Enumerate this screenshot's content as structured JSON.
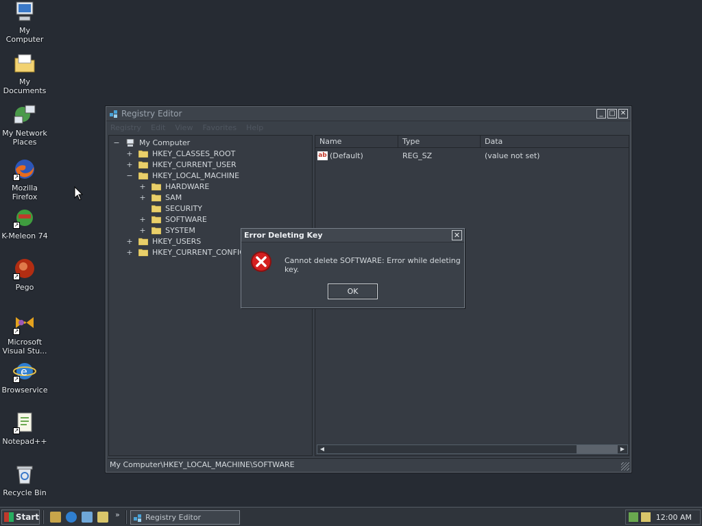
{
  "desktop": {
    "icons": [
      {
        "label": "My Computer",
        "icon": "computer-icon"
      },
      {
        "label": "My Documents",
        "icon": "documents-folder-icon"
      },
      {
        "label": "My Network Places",
        "icon": "network-places-icon"
      },
      {
        "label": "Mozilla Firefox",
        "icon": "firefox-icon"
      },
      {
        "label": "K-Meleon 74",
        "icon": "kmeleon-icon"
      },
      {
        "label": "Pego",
        "icon": "pego-icon"
      },
      {
        "label": "Microsoft Visual Stu...",
        "icon": "visual-studio-icon"
      },
      {
        "label": "Browservice",
        "icon": "internet-explorer-icon"
      },
      {
        "label": "Notepad++",
        "icon": "notepadpp-icon"
      },
      {
        "label": "Recycle Bin",
        "icon": "recycle-bin-icon"
      }
    ]
  },
  "registry": {
    "title": "Registry Editor",
    "menu": [
      "Registry",
      "Edit",
      "View",
      "Favorites",
      "Help"
    ],
    "tree": [
      {
        "label": "My Computer",
        "expander": "−",
        "level": 0,
        "icon": "computer-icon"
      },
      {
        "label": "HKEY_CLASSES_ROOT",
        "expander": "+",
        "level": 1
      },
      {
        "label": "HKEY_CURRENT_USER",
        "expander": "+",
        "level": 1
      },
      {
        "label": "HKEY_LOCAL_MACHINE",
        "expander": "−",
        "level": 1
      },
      {
        "label": "HARDWARE",
        "expander": "+",
        "level": 2
      },
      {
        "label": "SAM",
        "expander": "+",
        "level": 2
      },
      {
        "label": "SECURITY",
        "expander": "",
        "level": 2
      },
      {
        "label": "SOFTWARE",
        "expander": "+",
        "level": 2
      },
      {
        "label": "SYSTEM",
        "expander": "+",
        "level": 2
      },
      {
        "label": "HKEY_USERS",
        "expander": "+",
        "level": 1
      },
      {
        "label": "HKEY_CURRENT_CONFIG",
        "expander": "+",
        "level": 1
      }
    ],
    "columns": {
      "name": "Name",
      "type": "Type",
      "data": "Data"
    },
    "values": [
      {
        "name": "(Default)",
        "type": "REG_SZ",
        "data": "(value not set)"
      }
    ],
    "status": "My Computer\\HKEY_LOCAL_MACHINE\\SOFTWARE"
  },
  "dialog": {
    "title": "Error Deleting Key",
    "message": "Cannot delete SOFTWARE: Error while deleting key.",
    "ok_label": "OK"
  },
  "taskbar": {
    "start_label": "Start",
    "task_label": "Registry Editor",
    "clock": "12:00 AM",
    "more": "»"
  },
  "colors": {
    "desktop": "#262b33",
    "window": "#3a4048",
    "error_red": "#d42020"
  }
}
